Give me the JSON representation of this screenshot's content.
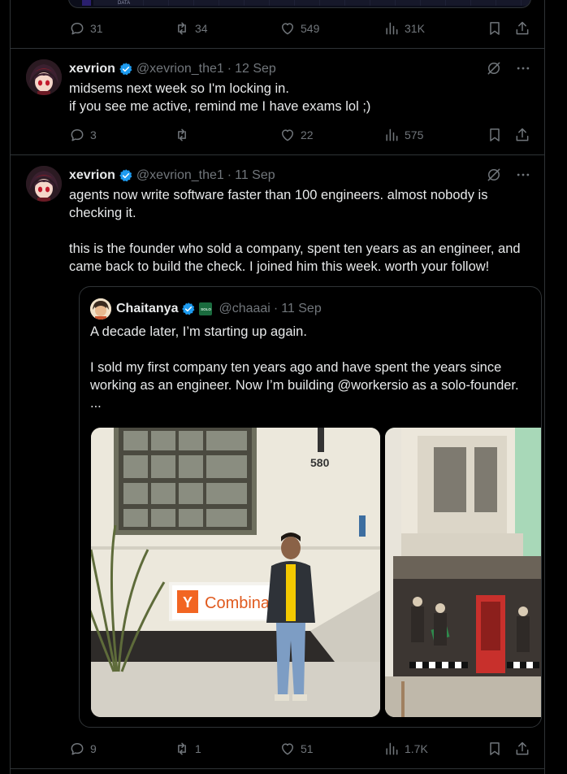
{
  "top_tweet": {
    "chart_residual_label": "DATA",
    "actions": {
      "replies": "31",
      "reposts": "34",
      "likes": "549",
      "views": "31K"
    }
  },
  "tweet1": {
    "name": "xevrion",
    "handle": "@xevrion_the1",
    "separator": "·",
    "date": "12 Sep",
    "text_line1": "midsems next week so I'm locking in.",
    "text_line2": "if you see me active, remind me I have exams lol ;)",
    "actions": {
      "replies": "3",
      "reposts": "",
      "likes": "22",
      "views": "575"
    }
  },
  "tweet2": {
    "name": "xevrion",
    "handle": "@xevrion_the1",
    "separator": "·",
    "date": "11 Sep",
    "para1": "agents now write software faster than 100 engineers. almost nobody is checking it.",
    "para2": "this is the founder who sold a company, spent ten years as an engineer, and came back to build the check. I joined him this week. worth your follow!",
    "quote": {
      "name": "Chaitanya",
      "badge": "SOLO",
      "handle": "@chaaai",
      "separator": "·",
      "date": "11 Sep",
      "para1": "A decade later, I’m starting up again.",
      "para2": "I sold my first company ten years ago and have spent the years since working as an engineer. Now I’m building @workersio as a solo-founder.",
      "ellipsis": "...",
      "photo1_sign_text": "Combinat",
      "photo1_sign_letter": "Y",
      "photo1_address": "580"
    },
    "actions": {
      "replies": "9",
      "reposts": "1",
      "likes": "51",
      "views": "1.7K"
    }
  },
  "colors": {
    "background": "#000000",
    "text": "#e7e9ea",
    "muted": "#71767b",
    "border": "#2f3336",
    "verified": "#1d9bf0",
    "yc_orange": "#f26522"
  }
}
